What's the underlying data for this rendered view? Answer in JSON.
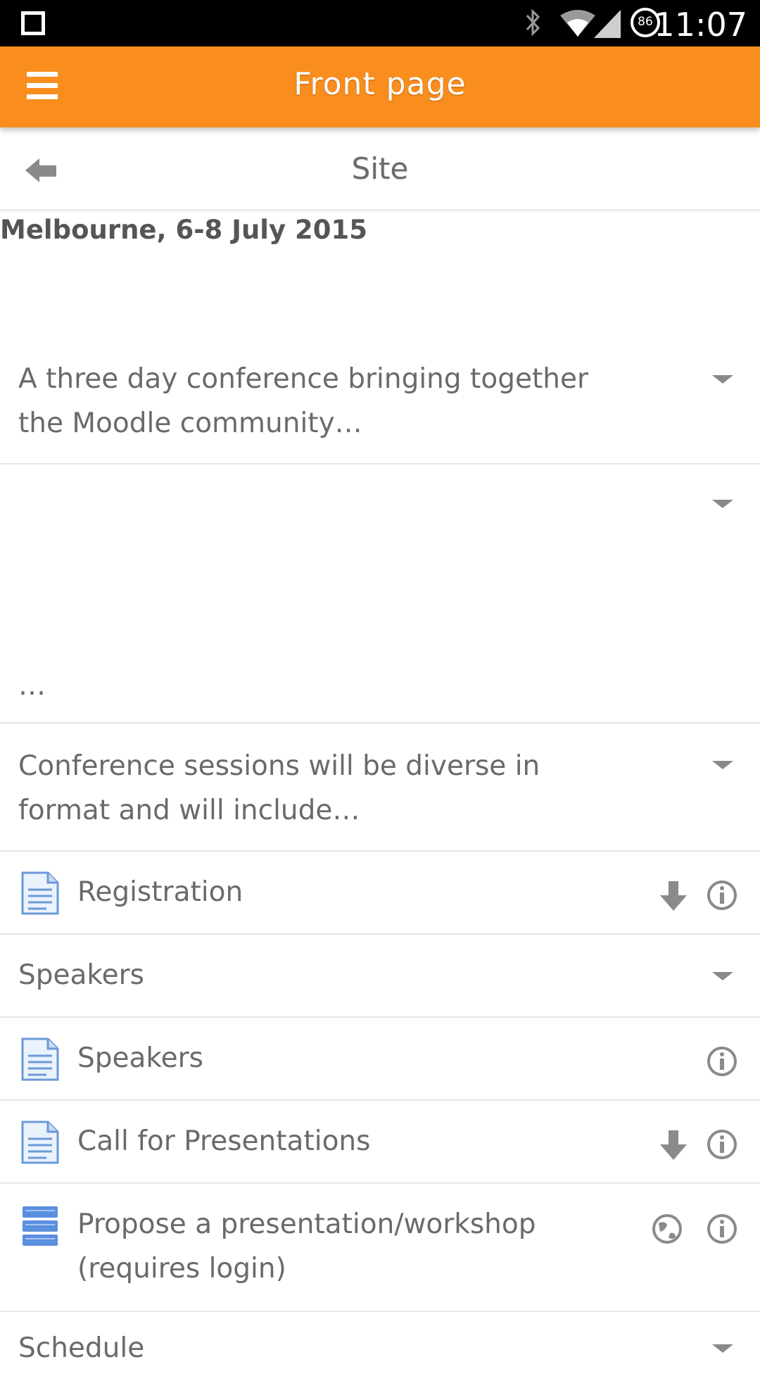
{
  "status_bar": {
    "time": "11:07",
    "battery": "86",
    "icons": [
      "square-icon",
      "bluetooth-icon",
      "wifi-icon",
      "signal-icon",
      "battery-icon"
    ]
  },
  "app_bar": {
    "title": "Front page",
    "menu_icon": "hamburger-menu-icon",
    "color": "#f98e1e"
  },
  "subheader": {
    "title": "Site",
    "back_icon": "back-arrow-icon"
  },
  "content": {
    "heading": "Melbourne, 6-8 July 2015",
    "summary_1_line1": "A three day conference bringing together",
    "summary_1_line2": "the Moodle community…",
    "summary_2": "…",
    "summary_3_line1": "Conference sessions will be diverse in",
    "summary_3_line2": "format and will include…",
    "registration": "Registration",
    "speakers_section": "Speakers",
    "speakers_item": "Speakers",
    "call_for_presentations": "Call for Presentations",
    "propose_line1": "Propose a presentation/workshop",
    "propose_line2": "(requires login)",
    "schedule": "Schedule"
  }
}
